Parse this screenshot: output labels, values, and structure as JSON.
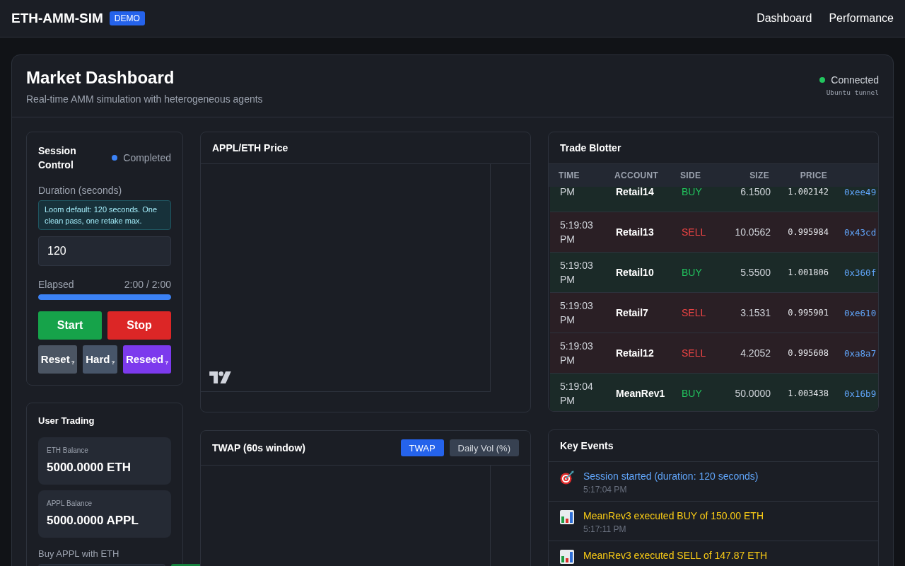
{
  "navbar": {
    "brand": "ETH-AMM-SIM",
    "badge": "DEMO",
    "links": [
      {
        "label": "Dashboard"
      },
      {
        "label": "Performance"
      }
    ]
  },
  "header": {
    "title": "Market Dashboard",
    "subtitle": "Real-time AMM simulation with heterogeneous agents",
    "connection": {
      "label": "Connected",
      "connected": true,
      "detail": "Ubuntu tunnel"
    }
  },
  "session_control": {
    "title": "Session Control",
    "status": {
      "label": "Completed",
      "kind": "completed"
    },
    "duration_label": "Duration (seconds)",
    "hint": "Loom default: 120 seconds. One clean pass, one retake max.",
    "duration_value": "120",
    "elapsed": {
      "label": "Elapsed",
      "reading": "2:00 / 2:00",
      "level": 1
    },
    "buttons": [
      {
        "label": "Start",
        "kind": "start"
      },
      {
        "label": "Stop",
        "kind": "stop"
      }
    ],
    "reset_buttons": [
      {
        "label": "Reset",
        "help": "?",
        "kind": "reset"
      },
      {
        "label": "Hard",
        "help": "?",
        "kind": "hard"
      },
      {
        "label": "Reseed",
        "help": "?",
        "kind": "reseed"
      }
    ]
  },
  "user_trading": {
    "title": "User Trading",
    "balances": [
      {
        "label": "ETH Balance",
        "value": "5000.0000 ETH"
      },
      {
        "label": "APPL Balance",
        "value": "5000.0000 APPL"
      }
    ],
    "buy_label": "Buy APPL with ETH"
  },
  "price_chart": {
    "title": "APPL/ETH Price"
  },
  "twap_chart": {
    "title": "TWAP (60s window)",
    "toggles": [
      {
        "label": "TWAP",
        "selected": true
      },
      {
        "label": "Daily Vol (%)",
        "selected": false
      }
    ]
  },
  "trade_blotter": {
    "title": "Trade Blotter",
    "columns": [
      "TIME",
      "ACCOUNT",
      "SIDE",
      "SIZE",
      "PRICE"
    ],
    "rows": [
      {
        "time": "PM",
        "account": "Retail14",
        "side": "BUY",
        "kind": "buy",
        "size": "6.1500",
        "price": "1.002142",
        "column_6": "0xee49"
      },
      {
        "time": "5:19:03 PM",
        "account": "Retail13",
        "side": "SELL",
        "kind": "sell",
        "size": "10.0562",
        "price": "0.995984",
        "column_6": "0x43cd"
      },
      {
        "time": "5:19:03 PM",
        "account": "Retail10",
        "side": "BUY",
        "kind": "buy",
        "size": "5.5500",
        "price": "1.001806",
        "column_6": "0x360f"
      },
      {
        "time": "5:19:03 PM",
        "account": "Retail7",
        "side": "SELL",
        "kind": "sell",
        "size": "3.1531",
        "price": "0.995901",
        "column_6": "0xe610"
      },
      {
        "time": "5:19:03 PM",
        "account": "Retail12",
        "side": "SELL",
        "kind": "sell",
        "size": "4.2052",
        "price": "0.995608",
        "column_6": "0xa8a7"
      },
      {
        "time": "5:19:04 PM",
        "account": "MeanRev1",
        "side": "BUY",
        "kind": "buy",
        "size": "50.0000",
        "price": "1.003438",
        "column_6": "0x16b9"
      }
    ]
  },
  "key_events": {
    "title": "Key Events",
    "items": [
      {
        "kind": "session",
        "text": "Session started (duration: 120 seconds)",
        "time": "5:17:04 PM"
      },
      {
        "kind": "trade",
        "text": "MeanRev3 executed BUY of 150.00 ETH",
        "time": "5:17:11 PM"
      },
      {
        "kind": "trade",
        "text": "MeanRev3 executed SELL of 147.87 ETH"
      }
    ]
  }
}
